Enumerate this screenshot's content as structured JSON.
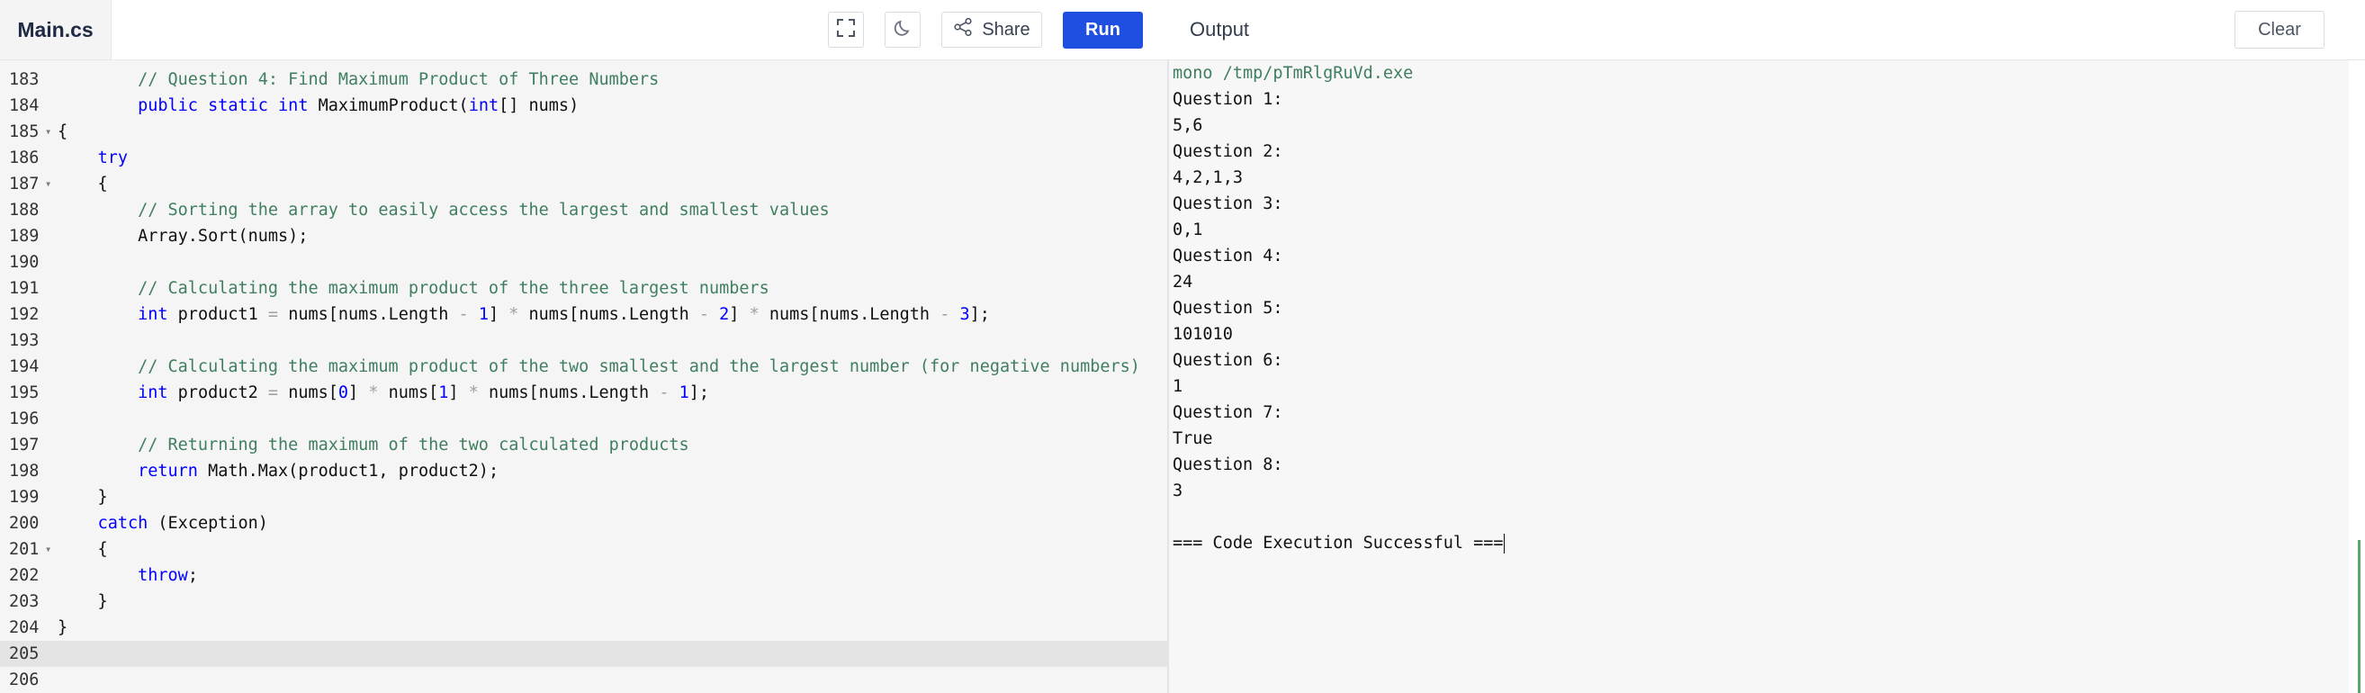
{
  "header": {
    "file_tab": "Main.cs",
    "share_label": "Share",
    "run_label": "Run",
    "output_title": "Output",
    "clear_label": "Clear"
  },
  "colors": {
    "run_button": "#1e4fe0",
    "keyword": "#0000ff",
    "type": "#0000ff",
    "comment": "#3f7f5f",
    "number": "#0000ff",
    "operator": "#a0a0a0",
    "output_command": "#3f7f5f"
  },
  "editor": {
    "active_line": 205,
    "lines": [
      {
        "n": "183",
        "fold": false,
        "tokens": [
          {
            "t": "        "
          },
          {
            "t": "// Question 4: Find Maximum Product of Three Numbers",
            "c": "comment"
          }
        ]
      },
      {
        "n": "184",
        "fold": false,
        "tokens": [
          {
            "t": "        "
          },
          {
            "t": "public",
            "c": "keyword"
          },
          {
            "t": " "
          },
          {
            "t": "static",
            "c": "keyword"
          },
          {
            "t": " "
          },
          {
            "t": "int",
            "c": "keyword"
          },
          {
            "t": " MaximumProduct("
          },
          {
            "t": "int",
            "c": "keyword"
          },
          {
            "t": "[] nums)"
          }
        ]
      },
      {
        "n": "185",
        "fold": true,
        "tokens": [
          {
            "t": "{"
          }
        ]
      },
      {
        "n": "186",
        "fold": false,
        "tokens": [
          {
            "t": "    "
          },
          {
            "t": "try",
            "c": "keyword"
          }
        ]
      },
      {
        "n": "187",
        "fold": true,
        "tokens": [
          {
            "t": "    {"
          }
        ]
      },
      {
        "n": "188",
        "fold": false,
        "tokens": [
          {
            "t": "        "
          },
          {
            "t": "// Sorting the array to easily access the largest and smallest values",
            "c": "comment"
          }
        ]
      },
      {
        "n": "189",
        "fold": false,
        "tokens": [
          {
            "t": "        Array.Sort(nums);"
          }
        ]
      },
      {
        "n": "190",
        "fold": false,
        "tokens": []
      },
      {
        "n": "191",
        "fold": false,
        "tokens": [
          {
            "t": "        "
          },
          {
            "t": "// Calculating the maximum product of the three largest numbers",
            "c": "comment"
          }
        ]
      },
      {
        "n": "192",
        "fold": false,
        "tokens": [
          {
            "t": "        "
          },
          {
            "t": "int",
            "c": "keyword"
          },
          {
            "t": " product1 "
          },
          {
            "t": "=",
            "c": "operator"
          },
          {
            "t": " nums[nums.Length "
          },
          {
            "t": "-",
            "c": "operator"
          },
          {
            "t": " "
          },
          {
            "t": "1",
            "c": "number"
          },
          {
            "t": "] "
          },
          {
            "t": "*",
            "c": "operator"
          },
          {
            "t": " nums[nums.Length "
          },
          {
            "t": "-",
            "c": "operator"
          },
          {
            "t": " "
          },
          {
            "t": "2",
            "c": "number"
          },
          {
            "t": "] "
          },
          {
            "t": "*",
            "c": "operator"
          },
          {
            "t": " nums[nums.Length "
          },
          {
            "t": "-",
            "c": "operator"
          },
          {
            "t": " "
          },
          {
            "t": "3",
            "c": "number"
          },
          {
            "t": "];"
          }
        ]
      },
      {
        "n": "193",
        "fold": false,
        "tokens": []
      },
      {
        "n": "194",
        "fold": false,
        "tokens": [
          {
            "t": "        "
          },
          {
            "t": "// Calculating the maximum product of the two smallest and the largest number (for negative numbers)",
            "c": "comment"
          }
        ]
      },
      {
        "n": "195",
        "fold": false,
        "tokens": [
          {
            "t": "        "
          },
          {
            "t": "int",
            "c": "keyword"
          },
          {
            "t": " product2 "
          },
          {
            "t": "=",
            "c": "operator"
          },
          {
            "t": " nums["
          },
          {
            "t": "0",
            "c": "number"
          },
          {
            "t": "] "
          },
          {
            "t": "*",
            "c": "operator"
          },
          {
            "t": " nums["
          },
          {
            "t": "1",
            "c": "number"
          },
          {
            "t": "] "
          },
          {
            "t": "*",
            "c": "operator"
          },
          {
            "t": " nums[nums.Length "
          },
          {
            "t": "-",
            "c": "operator"
          },
          {
            "t": " "
          },
          {
            "t": "1",
            "c": "number"
          },
          {
            "t": "];"
          }
        ]
      },
      {
        "n": "196",
        "fold": false,
        "tokens": []
      },
      {
        "n": "197",
        "fold": false,
        "tokens": [
          {
            "t": "        "
          },
          {
            "t": "// Returning the maximum of the two calculated products",
            "c": "comment"
          }
        ]
      },
      {
        "n": "198",
        "fold": false,
        "tokens": [
          {
            "t": "        "
          },
          {
            "t": "return",
            "c": "keyword"
          },
          {
            "t": " Math.Max(product1, product2);"
          }
        ]
      },
      {
        "n": "199",
        "fold": false,
        "tokens": [
          {
            "t": "    }"
          }
        ]
      },
      {
        "n": "200",
        "fold": false,
        "tokens": [
          {
            "t": "    "
          },
          {
            "t": "catch",
            "c": "keyword"
          },
          {
            "t": " (Exception)"
          }
        ]
      },
      {
        "n": "201",
        "fold": true,
        "tokens": [
          {
            "t": "    {"
          }
        ]
      },
      {
        "n": "202",
        "fold": false,
        "tokens": [
          {
            "t": "        "
          },
          {
            "t": "throw",
            "c": "keyword"
          },
          {
            "t": ";"
          }
        ]
      },
      {
        "n": "203",
        "fold": false,
        "tokens": [
          {
            "t": "    }"
          }
        ]
      },
      {
        "n": "204",
        "fold": false,
        "tokens": [
          {
            "t": "}"
          }
        ]
      },
      {
        "n": "205",
        "fold": false,
        "tokens": []
      },
      {
        "n": "206",
        "fold": false,
        "tokens": []
      }
    ]
  },
  "output": {
    "command": "mono /tmp/pTmRlgRuVd.exe",
    "lines": [
      "Question 1:",
      "5,6",
      "Question 2:",
      "4,2,1,3",
      "Question 3:",
      "0,1",
      "Question 4:",
      "24",
      "Question 5:",
      "101010",
      "Question 6:",
      "1",
      "Question 7:",
      "True",
      "Question 8:",
      "3",
      "",
      "=== Code Execution Successful ==="
    ]
  }
}
